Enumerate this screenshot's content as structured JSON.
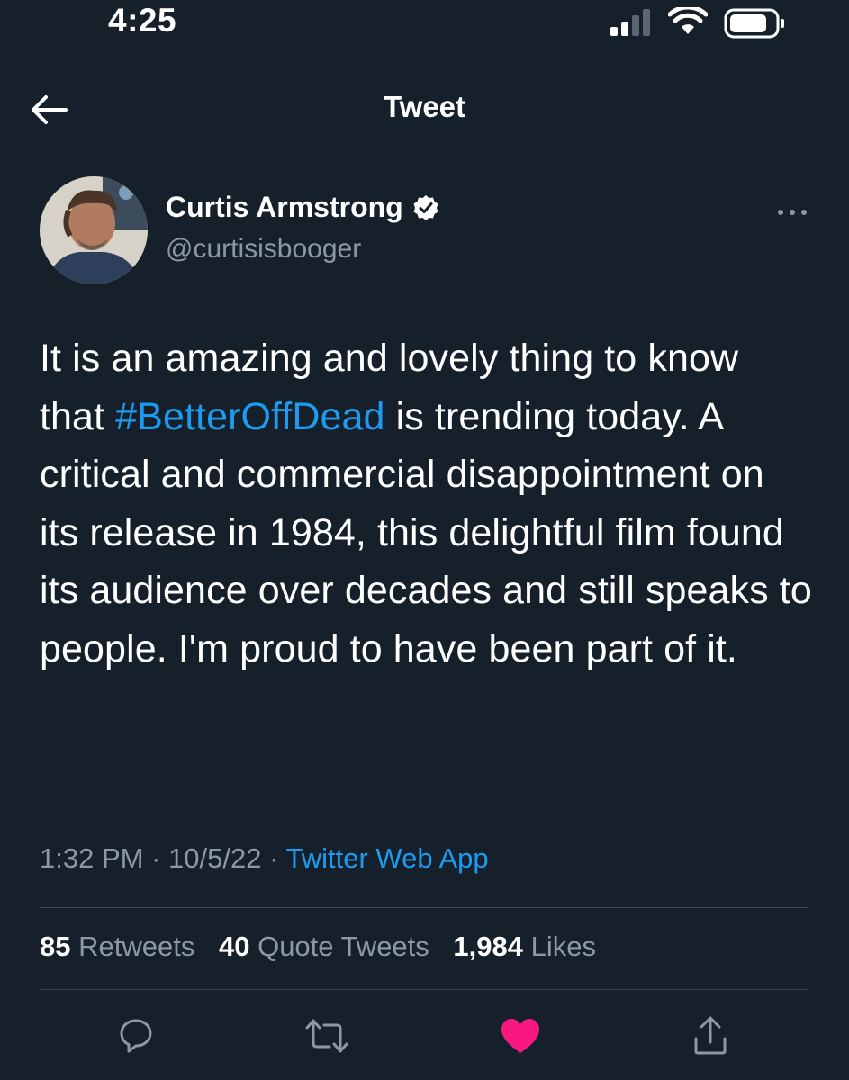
{
  "status_bar": {
    "time": "4:25"
  },
  "header": {
    "title": "Tweet",
    "back_icon": "arrow-left-icon"
  },
  "tweet": {
    "author": {
      "name": "Curtis Armstrong",
      "handle": "@curtisisbooger",
      "verified": true
    },
    "text_before_hashtag": "It is an amazing and lovely thing to know that ",
    "hashtag": "#BetterOffDead",
    "text_after_hashtag": " is trending today. A critical and commercial disappointment on its release in 1984, this delightful film found its audience over decades and still speaks to people. I'm proud to have been part of it.",
    "time": "1:32 PM",
    "date": "10/5/22",
    "separator": "·",
    "source": "Twitter Web App",
    "stats": {
      "retweets": "85",
      "retweets_label": "Retweets",
      "quote_tweets": "40",
      "quote_tweets_label": "Quote Tweets",
      "likes": "1,984",
      "likes_label": "Likes"
    },
    "liked": true
  },
  "colors": {
    "background": "#15202b",
    "accent": "#1d9bf0",
    "secondary_text": "#8b98a5",
    "like": "#f91880",
    "divider": "#38444d"
  },
  "icons": {
    "reply": "comment-icon",
    "retweet": "retweet-icon",
    "like": "heart-icon",
    "share": "share-icon",
    "more": "more-icon"
  }
}
